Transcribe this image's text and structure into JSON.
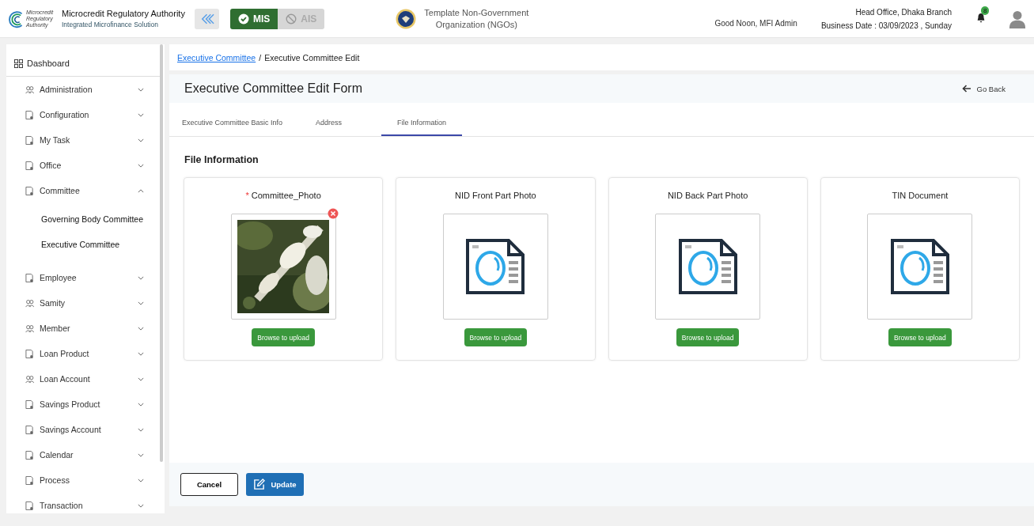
{
  "header": {
    "org_name": "Microcredit Regulatory Authority",
    "org_tagline": "Integrated Microfinance Solution",
    "logo_text": [
      "Microcredit",
      "Regulatory",
      "Authority"
    ],
    "modules": [
      {
        "label": "MIS",
        "selected": true
      },
      {
        "label": "AIS",
        "selected": false
      }
    ],
    "ngo_name": [
      "Template Non-Government",
      "Organization (NGOs)"
    ],
    "greeting": "Good Noon, MFI Admin",
    "office": "Head Office, Dhaka Branch",
    "business_date": "Business Date : 03/09/2023 , Sunday",
    "notification_count": "8"
  },
  "sidebar": {
    "dashboard": "Dashboard",
    "items": [
      {
        "label": "Administration",
        "expanded": false
      },
      {
        "label": "Configuration",
        "expanded": false
      },
      {
        "label": "My Task",
        "expanded": false
      },
      {
        "label": "Office",
        "expanded": false
      },
      {
        "label": "Committee",
        "expanded": true,
        "children": [
          {
            "label": "Governing Body Committee"
          },
          {
            "label": "Executive Committee"
          }
        ]
      },
      {
        "label": "Employee",
        "expanded": false
      },
      {
        "label": "Samity",
        "expanded": false
      },
      {
        "label": "Member",
        "expanded": false
      },
      {
        "label": "Loan Product",
        "expanded": false
      },
      {
        "label": "Loan Account",
        "expanded": false
      },
      {
        "label": "Savings Product",
        "expanded": false
      },
      {
        "label": "Savings Account",
        "expanded": false
      },
      {
        "label": "Calendar",
        "expanded": false
      },
      {
        "label": "Process",
        "expanded": false
      },
      {
        "label": "Transaction",
        "expanded": false
      }
    ]
  },
  "breadcrumb": {
    "link": "Executive Committee",
    "separator": "/",
    "current": "Executive Committee Edit"
  },
  "form": {
    "title": "Executive Committee Edit Form",
    "back": "Go Back",
    "tabs": [
      {
        "label": "Executive Committee Basic Info",
        "selected": false
      },
      {
        "label": "Address",
        "selected": false
      },
      {
        "label": "File Information",
        "selected": true
      }
    ],
    "section_title": "File Information",
    "files": [
      {
        "label": "Committee_Photo",
        "required": true,
        "kind": "picture",
        "removable": true,
        "button": "Browse to upload"
      },
      {
        "label": "NID Front Part Photo",
        "required": false,
        "kind": "placeholder",
        "removable": false,
        "button": "Browse to upload"
      },
      {
        "label": "NID Back Part Photo",
        "required": false,
        "kind": "placeholder",
        "removable": false,
        "button": "Browse to upload"
      },
      {
        "label": "TIN Document",
        "required": false,
        "kind": "placeholder",
        "removable": false,
        "button": "Browse to upload"
      }
    ],
    "required_mark": "*",
    "cancel": "Cancel",
    "update": "Update"
  }
}
